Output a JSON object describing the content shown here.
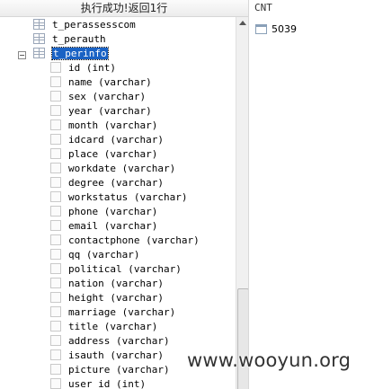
{
  "left_panel": {
    "status_text": "执行成功!返回1行",
    "tables": [
      {
        "name": "t_perassesscom"
      },
      {
        "name": "t_perauth"
      },
      {
        "name": "t_perinfo",
        "expander": "−"
      }
    ],
    "fields": [
      "id (int)",
      "name (varchar)",
      "sex (varchar)",
      "year (varchar)",
      "month (varchar)",
      "idcard (varchar)",
      "place (varchar)",
      "workdate (varchar)",
      "degree (varchar)",
      "workstatus (varchar)",
      "phone (varchar)",
      "email (varchar)",
      "contactphone (varchar)",
      "qq (varchar)",
      "political (varchar)",
      "nation (varchar)",
      "height (varchar)",
      "marriage (varchar)",
      "title (varchar)",
      "address (varchar)",
      "isauth (varchar)",
      "picture (varchar)",
      "user id (int)"
    ]
  },
  "right_panel": {
    "column_header": "CNT",
    "value": "5039"
  },
  "watermark": "www.wooyun.org",
  "colors": {
    "selection": "#1a62c4",
    "header_bg": "#ececec"
  }
}
